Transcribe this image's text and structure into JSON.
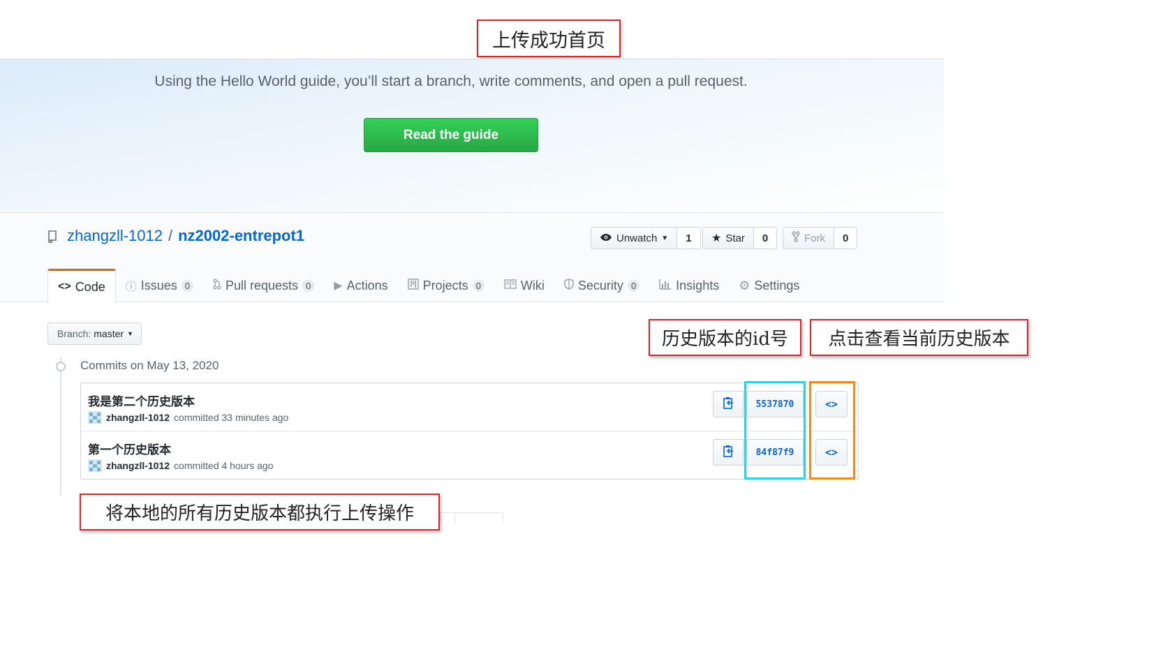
{
  "annotations": {
    "top": "上传成功首页",
    "sha_label": "历史版本的id号",
    "browse_label": "点击查看当前历史版本",
    "bottom": "将本地的所有历史版本都执行上传操作"
  },
  "hero": {
    "text": "Using the Hello World guide, you’ll start a branch, write comments, and open a pull request.",
    "button": "Read the guide"
  },
  "repo": {
    "owner": "zhangzll-1012",
    "separator": "/",
    "name": "nz2002-entrepot1"
  },
  "actions": {
    "watch": {
      "label": "Unwatch",
      "count": "1"
    },
    "star": {
      "label": "Star",
      "count": "0"
    },
    "fork": {
      "label": "Fork",
      "count": "0"
    }
  },
  "tabs": [
    {
      "label": "Code",
      "icon": "code-icon"
    },
    {
      "label": "Issues",
      "count": "0",
      "icon": "issue-icon"
    },
    {
      "label": "Pull requests",
      "count": "0",
      "icon": "pull-request-icon"
    },
    {
      "label": "Actions",
      "icon": "play-icon"
    },
    {
      "label": "Projects",
      "count": "0",
      "icon": "project-icon"
    },
    {
      "label": "Wiki",
      "icon": "book-icon"
    },
    {
      "label": "Security",
      "count": "0",
      "icon": "shield-icon"
    },
    {
      "label": "Insights",
      "icon": "graph-icon"
    },
    {
      "label": "Settings",
      "icon": "gear-icon"
    }
  ],
  "branch": {
    "label": "Branch:",
    "value": "master"
  },
  "commits": {
    "heading": "Commits on May 13, 2020",
    "items": [
      {
        "message": "我是第二个历史版本",
        "author": "zhangzll-1012",
        "committed": "committed 33 minutes ago",
        "sha": "5537870",
        "browse": "<>"
      },
      {
        "message": "第一个历史版本",
        "author": "zhangzll-1012",
        "committed": "committed 4 hours ago",
        "sha": "84f87f9",
        "browse": "<>"
      }
    ]
  },
  "colors": {
    "accent": "#0366d6",
    "primary_button": "#2ea44f",
    "active_tab": "#e36209",
    "annotation_red": "#e0242b",
    "highlight_cyan": "#28d3e6",
    "highlight_orange": "#f08a1d"
  }
}
